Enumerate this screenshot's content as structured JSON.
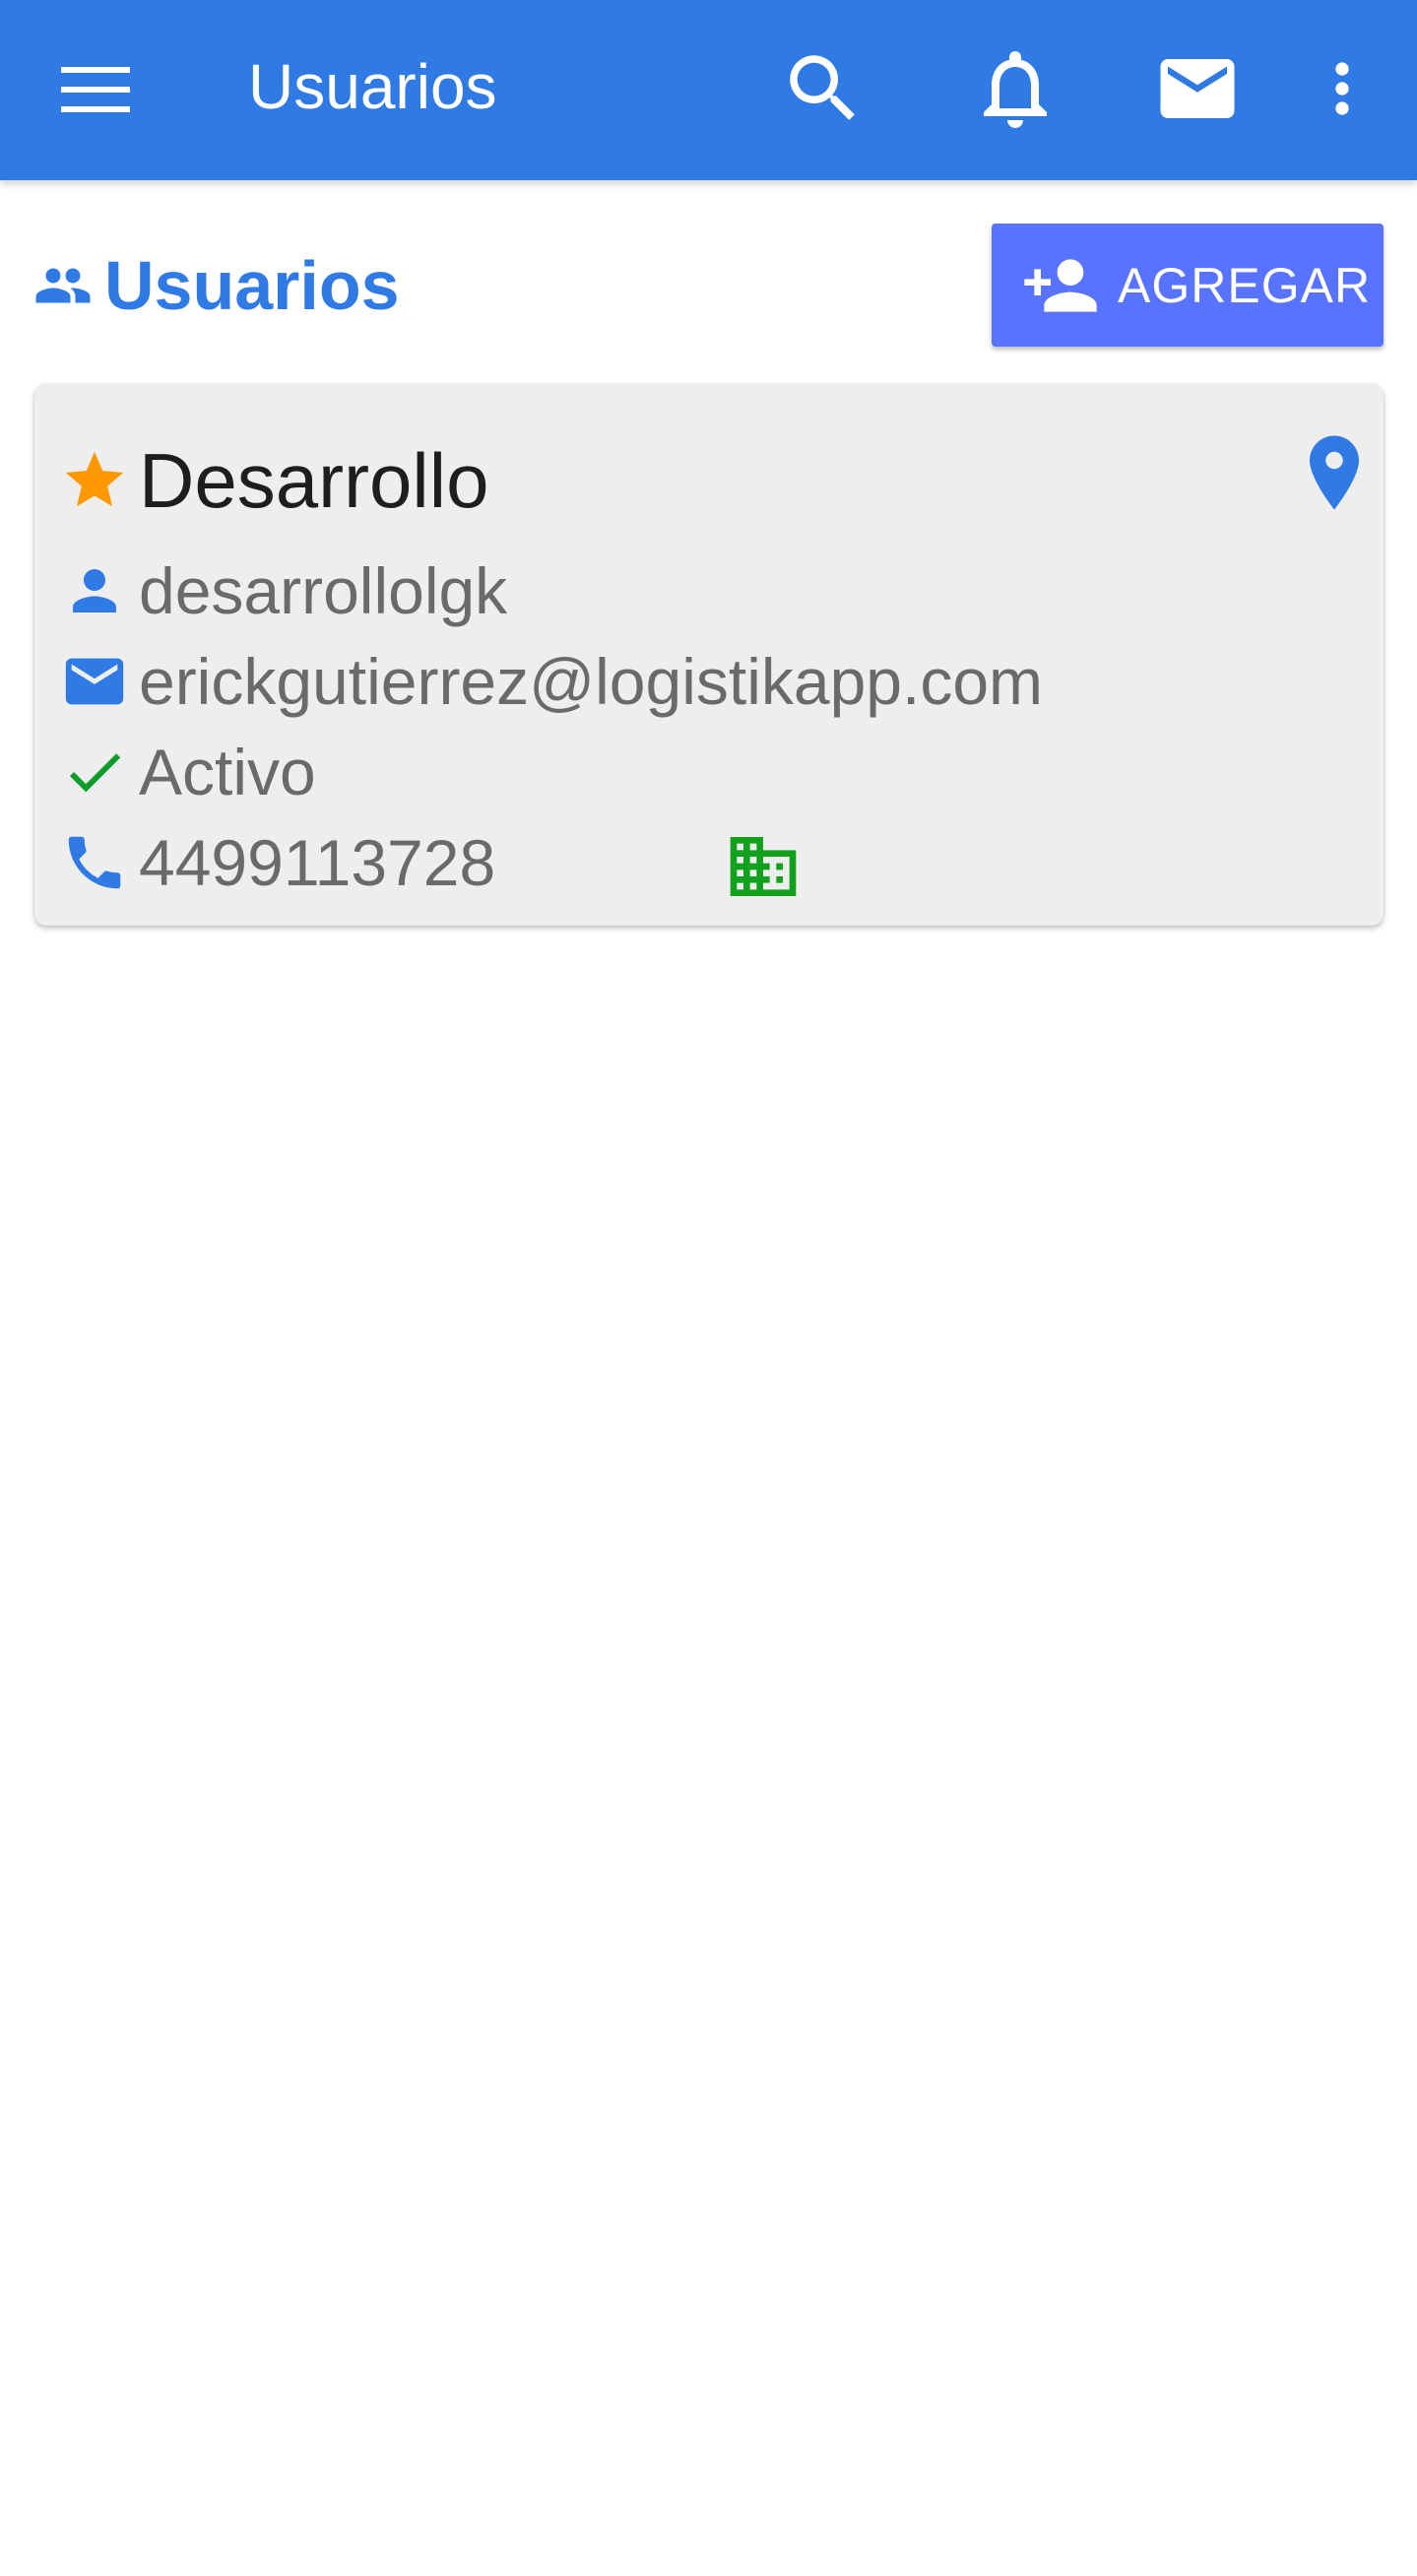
{
  "appbar": {
    "title": "Usuarios",
    "icons": [
      "menu-icon",
      "search-icon",
      "bell-icon",
      "mail-icon",
      "more-vert-icon"
    ]
  },
  "section": {
    "title": "Usuarios",
    "icon": "people-icon"
  },
  "add_button": {
    "label": "AGREGAR",
    "icon": "person-add-icon"
  },
  "user_card": {
    "name": "Desarrollo",
    "username": "desarrollolgk",
    "email": "erickgutierrez@logistikapp.com",
    "status": "Activo",
    "phone": "4499113728"
  },
  "colors": {
    "primary": "#2f7ae5",
    "button": "#5773ff",
    "star": "#ff9800",
    "active_check": "#0f9d2a",
    "building": "#12a11d",
    "card_bg": "#eeeeee"
  }
}
